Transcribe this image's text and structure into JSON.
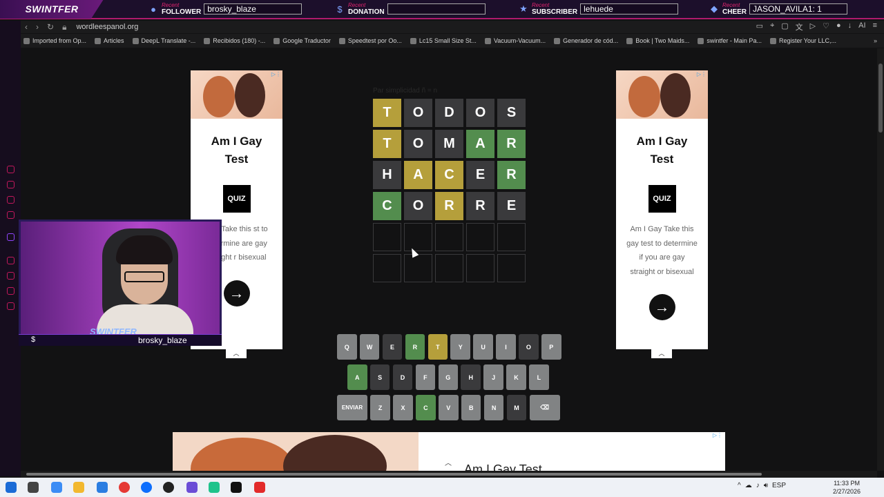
{
  "overlay": {
    "brand": "SWINTFER",
    "recent": "Recent",
    "follower": {
      "label": "FOLLOWER",
      "value": "brosky_blaze"
    },
    "donation": {
      "label": "DONATION",
      "value": ""
    },
    "subscriber": {
      "label": "SUBSCRIBER",
      "value": "lehuede"
    },
    "cheer": {
      "label": "CHEER",
      "value": "JASON_AVILA1: 1"
    }
  },
  "browser": {
    "url": "wordleespanol.org",
    "bookmarks": [
      "Imported from Op...",
      "Articles",
      "DeepL Translate -...",
      "Recibidos (180) -...",
      "Google Traductor",
      "Speedtest por Oo...",
      "Lc15 Small Size St...",
      "Vacuum-Vacuum...",
      "Generador de cód...",
      "Book | Two Maids...",
      "swintfer - Main Pa...",
      "Register Your LLC,..."
    ],
    "tools_label": "AI"
  },
  "game": {
    "hint": "Par simplicidad ñ = n",
    "rows": [
      [
        {
          "l": "T",
          "s": "y"
        },
        {
          "l": "O",
          "s": "a"
        },
        {
          "l": "D",
          "s": "a"
        },
        {
          "l": "O",
          "s": "a"
        },
        {
          "l": "S",
          "s": "a"
        }
      ],
      [
        {
          "l": "T",
          "s": "y"
        },
        {
          "l": "O",
          "s": "a"
        },
        {
          "l": "M",
          "s": "a"
        },
        {
          "l": "A",
          "s": "g"
        },
        {
          "l": "R",
          "s": "g"
        }
      ],
      [
        {
          "l": "H",
          "s": "a"
        },
        {
          "l": "A",
          "s": "y"
        },
        {
          "l": "C",
          "s": "y"
        },
        {
          "l": "E",
          "s": "a"
        },
        {
          "l": "R",
          "s": "g"
        }
      ],
      [
        {
          "l": "C",
          "s": "g"
        },
        {
          "l": "O",
          "s": "a"
        },
        {
          "l": "R",
          "s": "y"
        },
        {
          "l": "R",
          "s": "a"
        },
        {
          "l": "E",
          "s": "a"
        }
      ],
      [
        {
          "l": "",
          "s": "e"
        },
        {
          "l": "",
          "s": "e"
        },
        {
          "l": "",
          "s": "e"
        },
        {
          "l": "",
          "s": "e"
        },
        {
          "l": "",
          "s": "e"
        }
      ],
      [
        {
          "l": "",
          "s": "e"
        },
        {
          "l": "",
          "s": "e"
        },
        {
          "l": "",
          "s": "e"
        },
        {
          "l": "",
          "s": "e"
        },
        {
          "l": "",
          "s": "e"
        }
      ]
    ],
    "keyboard": [
      [
        {
          "k": "Q",
          "s": "u"
        },
        {
          "k": "W",
          "s": "u"
        },
        {
          "k": "E",
          "s": "a"
        },
        {
          "k": "R",
          "s": "g"
        },
        {
          "k": "T",
          "s": "y"
        },
        {
          "k": "Y",
          "s": "u"
        },
        {
          "k": "U",
          "s": "u"
        },
        {
          "k": "I",
          "s": "u"
        },
        {
          "k": "O",
          "s": "a"
        },
        {
          "k": "P",
          "s": "u"
        }
      ],
      [
        {
          "k": "A",
          "s": "g"
        },
        {
          "k": "S",
          "s": "a"
        },
        {
          "k": "D",
          "s": "a"
        },
        {
          "k": "F",
          "s": "u"
        },
        {
          "k": "G",
          "s": "u"
        },
        {
          "k": "H",
          "s": "a"
        },
        {
          "k": "J",
          "s": "u"
        },
        {
          "k": "K",
          "s": "u"
        },
        {
          "k": "L",
          "s": "u"
        }
      ],
      [
        {
          "k": "ENVIAR",
          "s": "u",
          "w": "enter"
        },
        {
          "k": "Z",
          "s": "u"
        },
        {
          "k": "X",
          "s": "u"
        },
        {
          "k": "C",
          "s": "g"
        },
        {
          "k": "V",
          "s": "u"
        },
        {
          "k": "B",
          "s": "u"
        },
        {
          "k": "N",
          "s": "u"
        },
        {
          "k": "M",
          "s": "a"
        },
        {
          "k": "⌫",
          "s": "u",
          "w": "back"
        }
      ]
    ]
  },
  "ads": {
    "title": "Am I Gay Test",
    "quiz": "QUIZ",
    "desc_left": "Gay Take this st to determine are gay straight r bisexual",
    "desc_right": "Am I Gay Take this gay test to determine if you are gay straight or bisexual",
    "bottom_title": "Am I Gay Test"
  },
  "webcam": {
    "brand": "SWINTFER",
    "name": "brosky_blaze",
    "donate_icon": "$"
  },
  "taskbar": {
    "lang": "ESP",
    "time": "11:33 PM",
    "date": "2/27/2026"
  }
}
